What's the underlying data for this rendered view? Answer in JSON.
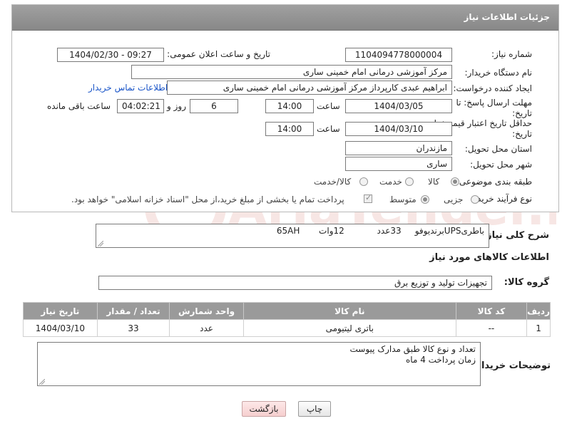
{
  "header": {
    "title": "جزئیات اطلاعات نیاز"
  },
  "form": {
    "need_number_label": "شماره نیاز:",
    "need_number": "1104094778000004",
    "announce_label": "تاریخ و ساعت اعلان عمومی:",
    "announce_value": "1404/02/30 - 09:27",
    "buyer_org_label": "نام دستگاه خریدار:",
    "buyer_org": "مرکز آموزشی درمانی امام خمینی ساری",
    "requester_label": "ایجاد کننده درخواست:",
    "requester": "ابراهیم عبدی کارپرداز مرکز آموزشی درمانی امام خمینی ساری",
    "contact_link": "اطلاعات تماس خریدار",
    "reply_deadline_label": "مهلت ارسال پاسخ: تا تاریخ:",
    "reply_date": "1404/03/05",
    "time_label": "ساعت",
    "reply_time": "14:00",
    "days_value": "6",
    "days_label": "روز و",
    "remaining_time": "04:02:21",
    "remaining_label": "ساعت باقی مانده",
    "price_validity_label": "حداقل تاریخ اعتبار قیمت: تا تاریخ:",
    "price_date": "1404/03/10",
    "price_time": "14:00",
    "province_label": "استان محل تحویل:",
    "province": "مازندران",
    "city_label": "شهر محل تحویل:",
    "city": "ساری",
    "category_label": "طبقه بندی موضوعی:",
    "category_options": [
      "کالا",
      "خدمت",
      "کالا/خدمت"
    ],
    "process_label": "نوع فرآیند خرید :",
    "process_options": [
      "جزیی",
      "متوسط"
    ],
    "payment_note": "پرداخت تمام یا بخشی از مبلغ خرید،از محل \"اسناد خزانه اسلامی\" خواهد بود."
  },
  "summary": {
    "label": "شرح کلی نیاز:",
    "text": "باطریUPSبرندیوفو     33عدد            12وات       65AH"
  },
  "goods_info": {
    "title": "اطلاعات کالاهای مورد نیاز",
    "group_label": "گروه کالا:",
    "group_value": "تجهیزات تولید و توزیع برق"
  },
  "table": {
    "headers": [
      "ردیف",
      "کد کالا",
      "نام کالا",
      "واحد شمارش",
      "تعداد / مقدار",
      "تاریخ نیاز"
    ],
    "rows": [
      [
        "1",
        "--",
        "باتری لیتیومی",
        "عدد",
        "33",
        "1404/03/10"
      ]
    ]
  },
  "buyer_notes": {
    "label": "توضیحات خریدار:",
    "lines": [
      "تعداد و نوع کالا طبق مدارک پیوست",
      "زمان پرداخت 4 ماه"
    ]
  },
  "buttons": {
    "print": "چاپ",
    "back": "بازگشت"
  },
  "watermark_text": "AriaTender.net",
  "colors": {
    "header_bg": "#929292",
    "link": "#1a55c8",
    "back_button": "#f6cfcf"
  }
}
